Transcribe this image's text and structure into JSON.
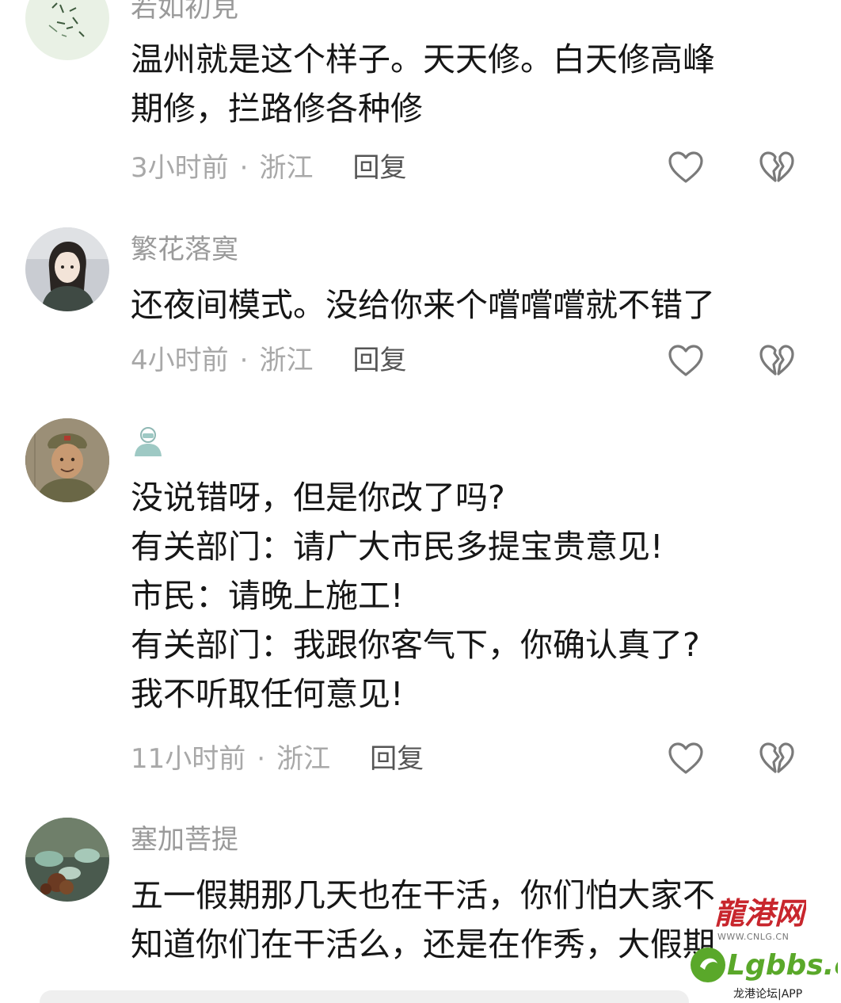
{
  "comments": [
    {
      "username": "若如初見",
      "lines": [
        "温州就是这个样子。天天修。白天修高峰",
        "期修，拦路修各种修"
      ],
      "time": "3小时前",
      "location": "浙江",
      "reply_label": "回复"
    },
    {
      "username": "繁花落寞",
      "lines": [
        "还夜间模式。没给你来个嚐嚐嚐就不错了"
      ],
      "time": "4小时前",
      "location": "浙江",
      "reply_label": "回复"
    },
    {
      "username": "",
      "lines": [
        "没说错呀，但是你改了吗?",
        "有关部门：请广大市民多提宝贵意见!",
        "市民：请晚上施工!",
        "有关部门：我跟你客气下，你确认真了?",
        "我不听取任何意见!"
      ],
      "time": "11小时前",
      "location": "浙江",
      "reply_label": "回复"
    },
    {
      "username": "塞加菩提",
      "lines": [
        "五一假期那几天也在干活，你们怕大家不",
        "知道你们在干活么，还是在作秀，大假期"
      ],
      "time": "",
      "location": "",
      "reply_label": ""
    }
  ],
  "separator": "·",
  "icons": {
    "like": "heart-outline-icon",
    "dislike": "broken-heart-icon"
  },
  "watermark": {
    "logo_text": "龍港网",
    "url": "WWW.CNLG.CN",
    "brand": "Lgbbs.cn",
    "subtitle": "龙港论坛|APP"
  },
  "colors": {
    "meta": "#a8a8a8",
    "reply": "#555555",
    "watermark_red": "#c8262d",
    "watermark_green": "#5aa82a"
  }
}
